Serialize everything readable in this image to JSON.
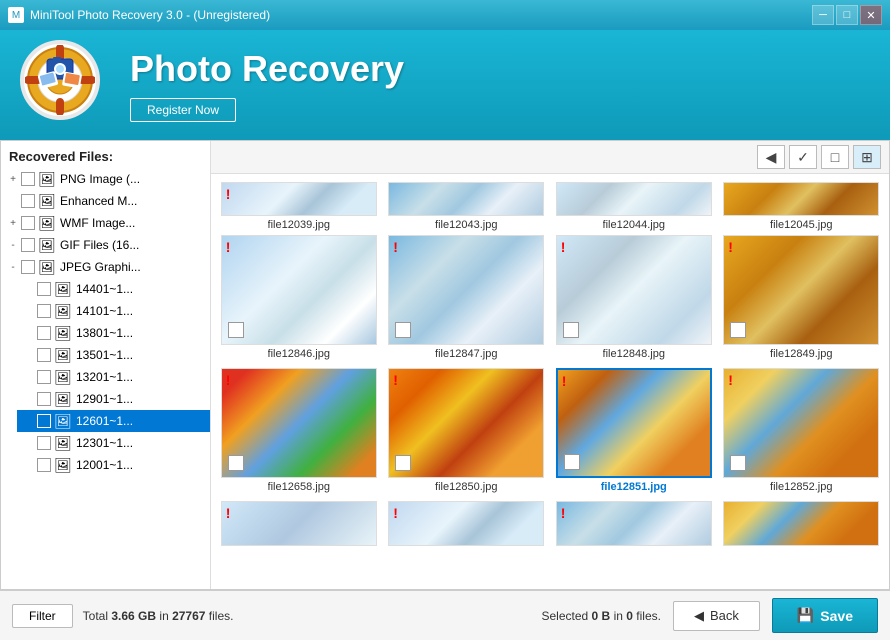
{
  "titlebar": {
    "title": "MiniTool Photo Recovery 3.0 - (Unregistered)",
    "minimize": "─",
    "maximize": "□",
    "close": "✕"
  },
  "header": {
    "title": "Photo Recovery",
    "register_label": "Register Now",
    "logo_emoji": "🛟"
  },
  "toolbar": {
    "back_btn": "◀",
    "check_btn": "✓",
    "single_btn": "□",
    "grid_btn": "⊞"
  },
  "sidebar": {
    "label": "Recovered Files:",
    "items": [
      {
        "id": "png",
        "indent": 0,
        "expand": "+",
        "label": "PNG Image (...",
        "icon": "🖼",
        "selected": false
      },
      {
        "id": "enhanced",
        "indent": 0,
        "expand": " ",
        "label": "Enhanced M...",
        "icon": "🖼",
        "selected": false
      },
      {
        "id": "wmf",
        "indent": 0,
        "expand": "+",
        "label": "WMF Image...",
        "icon": "🖼",
        "selected": false
      },
      {
        "id": "gif",
        "indent": 0,
        "expand": "-",
        "label": "GIF Files (16...",
        "icon": "🖼",
        "selected": false
      },
      {
        "id": "jpeg",
        "indent": 0,
        "expand": "-",
        "label": "JPEG Graphi...",
        "icon": "🖼",
        "selected": false
      },
      {
        "id": "r14401",
        "indent": 2,
        "expand": " ",
        "label": "14401~1...",
        "icon": "🖼",
        "selected": false
      },
      {
        "id": "r14101",
        "indent": 2,
        "expand": " ",
        "label": "14101~1...",
        "icon": "🖼",
        "selected": false
      },
      {
        "id": "r13801",
        "indent": 2,
        "expand": " ",
        "label": "13801~1...",
        "icon": "🖼",
        "selected": false
      },
      {
        "id": "r13501",
        "indent": 2,
        "expand": " ",
        "label": "13501~1...",
        "icon": "🖼",
        "selected": false
      },
      {
        "id": "r13201",
        "indent": 2,
        "expand": " ",
        "label": "13201~1...",
        "icon": "🖼",
        "selected": false
      },
      {
        "id": "r12901",
        "indent": 2,
        "expand": " ",
        "label": "12901~1...",
        "icon": "🖼",
        "selected": false
      },
      {
        "id": "r12601",
        "indent": 2,
        "expand": " ",
        "label": "12601~1...",
        "icon": "🖼",
        "selected": true
      },
      {
        "id": "r12301",
        "indent": 2,
        "expand": " ",
        "label": "12301~1...",
        "icon": "🖼",
        "selected": false
      },
      {
        "id": "r12001",
        "indent": 2,
        "expand": " ",
        "label": "12001~1...",
        "icon": "🖼",
        "selected": false
      }
    ]
  },
  "grid": {
    "top_row_labels": [
      "file12039.jpg",
      "file12043.jpg",
      "file12044.jpg",
      "file12045.jpg"
    ],
    "rows": [
      {
        "cells": [
          {
            "id": "file12846",
            "label": "file12846.jpg",
            "img_class": "img-snow",
            "selected": false,
            "warning": true
          },
          {
            "id": "file12847",
            "label": "file12847.jpg",
            "img_class": "img-ski",
            "selected": false,
            "warning": true
          },
          {
            "id": "file12848",
            "label": "file12848.jpg",
            "img_class": "img-snow2",
            "selected": false,
            "warning": true
          },
          {
            "id": "file12849",
            "label": "file12849.jpg",
            "img_class": "img-tiger",
            "selected": false,
            "warning": true
          }
        ]
      },
      {
        "cells": [
          {
            "id": "file12658",
            "label": "file12658.jpg",
            "img_class": "img-toys",
            "selected": false,
            "warning": true
          },
          {
            "id": "file12850",
            "label": "file12850.jpg",
            "img_class": "img-sunset",
            "selected": false,
            "warning": true
          },
          {
            "id": "file12851",
            "label": "file12851.jpg",
            "img_class": "img-beach",
            "selected": true,
            "warning": true
          },
          {
            "id": "file12852",
            "label": "file12852.jpg",
            "img_class": "img-beach2",
            "selected": false,
            "warning": true
          }
        ]
      }
    ],
    "partial_labels": [
      "",
      "",
      "",
      ""
    ]
  },
  "statusbar": {
    "filter_label": "Filter",
    "total_text": "Total ",
    "total_size": "3.66 GB",
    "total_in": " in ",
    "total_files": "27767",
    "total_files_label": " files.",
    "selected_prefix": "Selected ",
    "selected_size": "0 B",
    "selected_in": " in ",
    "selected_count": "0",
    "selected_suffix": " files.",
    "back_label": "Back",
    "save_label": "Save"
  }
}
